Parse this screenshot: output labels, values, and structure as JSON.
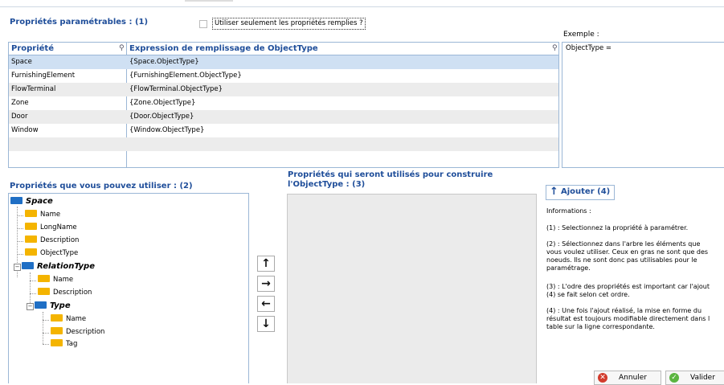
{
  "section1": {
    "title": "Propriétés paramétrables : (1)",
    "checkbox_label": "Utiliser seulement les propriétés remplies ?",
    "checkbox_checked": false
  },
  "grid": {
    "col1_header": "Propriété",
    "col2_header": "Expression de remplissage de ObjectType",
    "rows": [
      {
        "prop": "Space",
        "expr": "{Space.ObjectType}"
      },
      {
        "prop": "FurnishingElement",
        "expr": "{FurnishingElement.ObjectType}"
      },
      {
        "prop": "FlowTerminal",
        "expr": "{FlowTerminal.ObjectType}"
      },
      {
        "prop": "Zone",
        "expr": "{Zone.ObjectType}"
      },
      {
        "prop": "Door",
        "expr": "{Door.ObjectType}"
      },
      {
        "prop": "Window",
        "expr": "{Window.ObjectType}"
      }
    ]
  },
  "example": {
    "label": "Exemple :",
    "text": "ObjectType ="
  },
  "section2": {
    "title": "Propriétés que vous pouvez utiliser : (2)"
  },
  "section3": {
    "title_line1": "Propriétés qui seront utilisés pour construire",
    "title_line2": "l'ObjectType : (3)"
  },
  "tree": {
    "root": "Space",
    "root_children": [
      "Name",
      "LongName",
      "Description",
      "ObjectType"
    ],
    "relation": "RelationType",
    "relation_children": [
      "Name",
      "Description"
    ],
    "type": "Type",
    "type_children": [
      "Name",
      "Description",
      "Tag"
    ]
  },
  "add_button": {
    "label": "Ajouter (4)"
  },
  "info": {
    "heading": "Informations :",
    "p1": "(1) : Selectionnez la propriété à paramétrer.",
    "p2_l1": "(2) : Sélectionnez dans l'arbre les éléments que",
    "p2_l2": "vous voulez utiliser. Ceux en gras ne sont que des",
    "p2_l3": "noeuds. Ils ne sont donc pas utilisables pour le",
    "p2_l4": "paramétrage.",
    "p3_l1": "(3) : L'odre des propriétés est important car l'ajout",
    "p3_l2": "(4) se fait selon cet ordre.",
    "p4_l1": "(4) : Une fois l'ajout réalisé, la mise en forme du",
    "p4_l2": "résultat est toujours modifiable directement dans l",
    "p4_l3": "table sur la ligne correspondante."
  },
  "buttons": {
    "cancel": "Annuler",
    "ok": "Valider"
  },
  "arrows": {
    "up": "↑",
    "right": "→",
    "left": "←",
    "down": "↓"
  },
  "colors": {
    "accent": "#1f4e9a",
    "selected_row": "#cfe0f3"
  }
}
